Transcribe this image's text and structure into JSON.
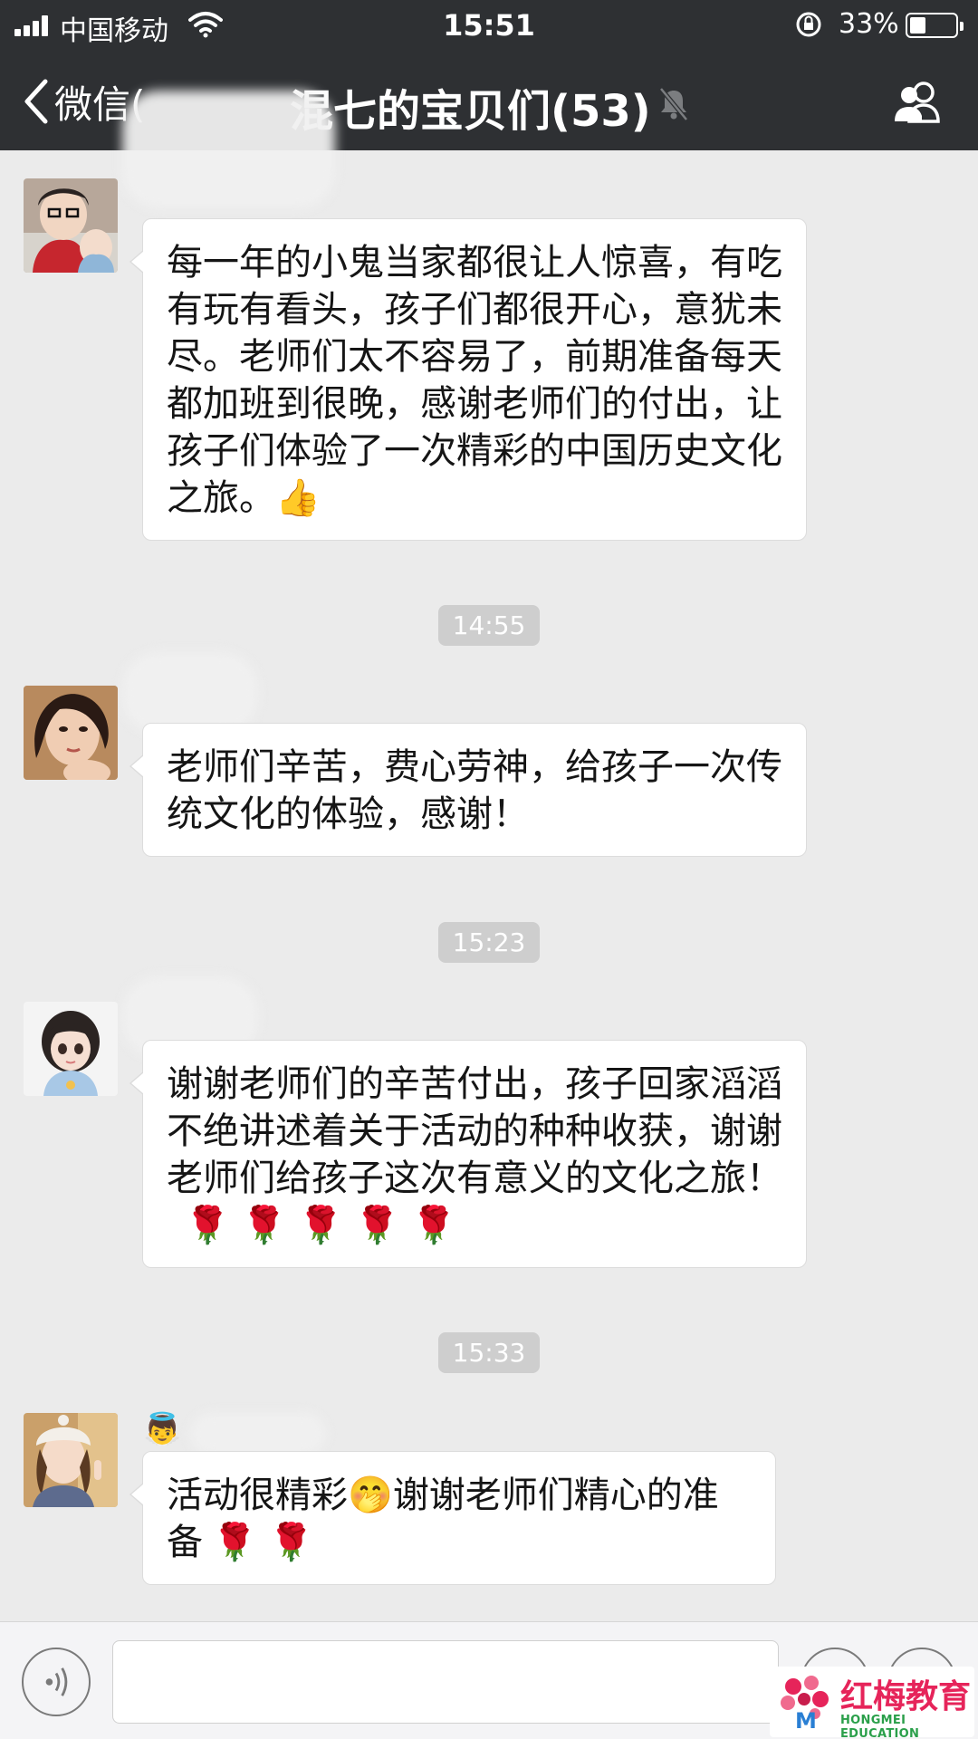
{
  "status_bar": {
    "carrier": "中国移动",
    "time": "15:51",
    "battery_percent": "33%",
    "battery_level": 0.33
  },
  "nav": {
    "back_label": "微信(",
    "title": "混七的宝贝们(53)"
  },
  "messages": [
    {
      "text": "每一年的小鬼当家都很让人惊喜，有吃有玩有看头，孩子们都很开心，意犹未尽。老师们太不容易了，前期准备每天都加班到很晚，感谢老师们的付出，让孩子们体验了一次精彩的中国历史文化之旅。",
      "emoji": "👍"
    },
    {
      "text": "老师们辛苦，费心劳神，给孩子一次传统文化的体验，感谢！"
    },
    {
      "text": "谢谢老师们的辛苦付出，孩子回家滔滔不绝讲述着关于活动的种种收获，谢谢老师们给孩子这次有意义的文化之旅！",
      "emoji": "🌹 🌹 🌹 🌹 🌹"
    },
    {
      "text_a": "活动很精彩",
      "emoji_a": "🤭",
      "text_b": "谢谢老师们精心的准备",
      "emoji_b": "🌹 🌹",
      "sender_emoji": "👼"
    }
  ],
  "timestamps": [
    "14:55",
    "15:23",
    "15:33"
  ],
  "watermark": {
    "name_cn": "红梅教育",
    "name_en": "HONGMEI EDUCATION"
  },
  "colors": {
    "topbar": "#2e3033",
    "background": "#ebebeb",
    "timestamp_bg": "#cecece",
    "logo_red": "#e6245a",
    "logo_green": "#2a9f4a"
  }
}
